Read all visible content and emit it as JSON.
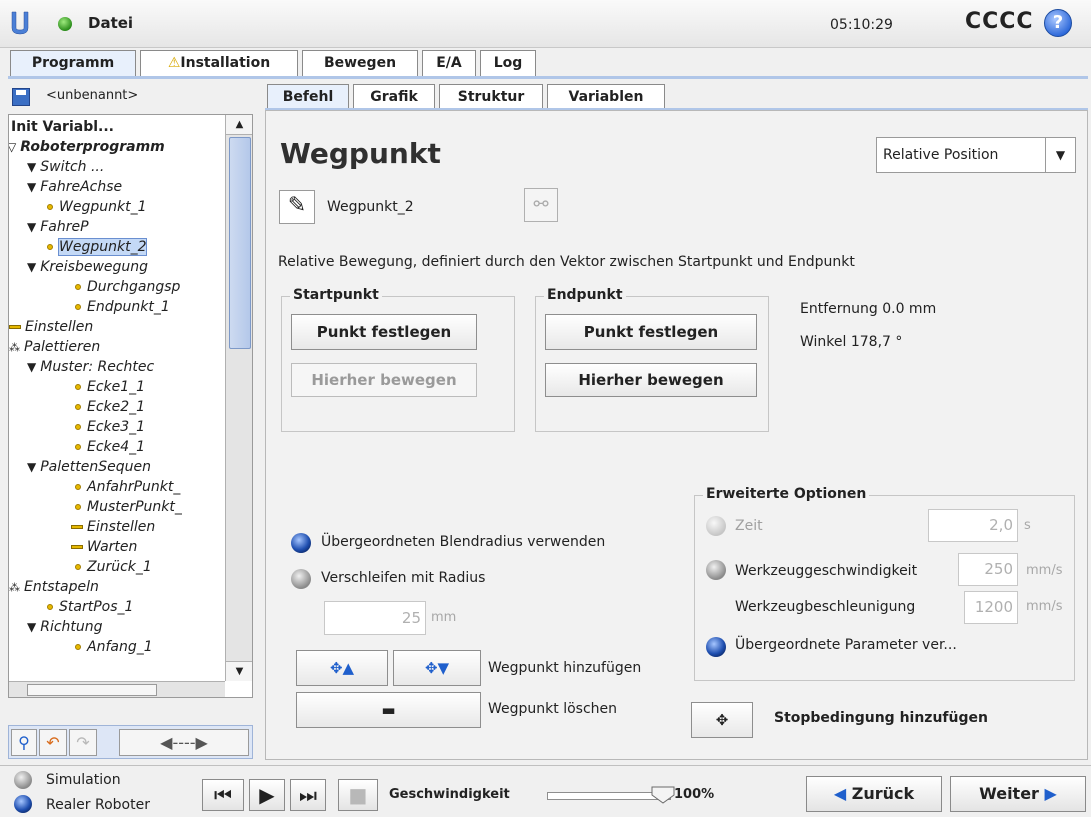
{
  "topbar": {
    "file_label": "Datei",
    "clock": "05:10:29",
    "robot_name": "CCCC",
    "help": "?"
  },
  "main_tabs": [
    {
      "label": "Programm",
      "active": true
    },
    {
      "label": "Installation",
      "warning": true
    },
    {
      "label": "Bewegen"
    },
    {
      "label": "E/A"
    },
    {
      "label": "Log"
    }
  ],
  "program": {
    "name": "<unbenannt>"
  },
  "tree": [
    {
      "label": "Init Variabl...",
      "style": "bold"
    },
    {
      "label": "Roboterprogramm",
      "style": "bolditalic"
    },
    {
      "label": "Switch ..."
    },
    {
      "label": "FahreAchse"
    },
    {
      "label": "Wegpunkt_1"
    },
    {
      "label": "FahreP"
    },
    {
      "label": "Wegpunkt_2",
      "selected": true
    },
    {
      "label": "Kreisbewegung"
    },
    {
      "label": "Durchgangsp"
    },
    {
      "label": "Endpunkt_1"
    },
    {
      "label": "Einstellen"
    },
    {
      "label": "Palettieren"
    },
    {
      "label": "Muster: Rechtec"
    },
    {
      "label": "Ecke1_1"
    },
    {
      "label": "Ecke2_1"
    },
    {
      "label": "Ecke3_1"
    },
    {
      "label": "Ecke4_1"
    },
    {
      "label": "PalettenSequen"
    },
    {
      "label": "AnfahrPunkt_"
    },
    {
      "label": "MusterPunkt_"
    },
    {
      "label": "Einstellen"
    },
    {
      "label": "Warten"
    },
    {
      "label": "Zurück_1"
    },
    {
      "label": "Entstapeln"
    },
    {
      "label": "StartPos_1"
    },
    {
      "label": "Richtung"
    },
    {
      "label": "Anfang_1"
    }
  ],
  "sub_tabs": [
    {
      "label": "Befehl",
      "active": true
    },
    {
      "label": "Grafik"
    },
    {
      "label": "Struktur"
    },
    {
      "label": "Variablen"
    }
  ],
  "waypoint": {
    "title": "Wegpunkt",
    "type_select": "Relative Position",
    "name": "Wegpunkt_2",
    "description": "Relative Bewegung, definiert durch den Vektor zwischen Startpunkt und Endpunkt"
  },
  "startpoint": {
    "title": "Startpunkt",
    "set_label": "Punkt festlegen",
    "move_label": "Hierher bewegen"
  },
  "endpoint": {
    "title": "Endpunkt",
    "set_label": "Punkt festlegen",
    "move_label": "Hierher bewegen"
  },
  "info": {
    "distance": "Entfernung 0.0 mm",
    "angle": "Winkel 178,7 °"
  },
  "blend": {
    "use_parent": "Übergeordneten Blendradius verwenden",
    "radius_label": "Verschleifen mit Radius",
    "radius_value": "25",
    "radius_unit": "mm"
  },
  "waypoint_actions": {
    "add_label": "Wegpunkt hinzufügen",
    "delete_label": "Wegpunkt löschen"
  },
  "advanced": {
    "title": "Erweiterte Optionen",
    "time_label": "Zeit",
    "time_value": "2,0",
    "time_unit": "s",
    "tool_speed_label": "Werkzeuggeschwindigkeit",
    "tool_speed_value": "250",
    "tool_speed_unit": "mm/s",
    "tool_accel_label": "Werkzeugbeschleunigung",
    "tool_accel_value": "1200",
    "tool_accel_unit": "mm/s",
    "parent_params_label": "Übergeordnete Parameter ver..."
  },
  "stop_condition": {
    "label": "Stopbedingung hinzufügen"
  },
  "bottombar": {
    "simulation": "Simulation",
    "real_robot": "Realer Roboter",
    "speed_label": "Geschwindigkeit",
    "speed_value": "100%",
    "speed_fraction": 1.0,
    "back_label": "Zurück",
    "next_label": "Weiter"
  },
  "colors": {
    "accent": "#1f5fcc",
    "selection": "#c4d9f6",
    "status_ok": "#2a8c1a"
  }
}
